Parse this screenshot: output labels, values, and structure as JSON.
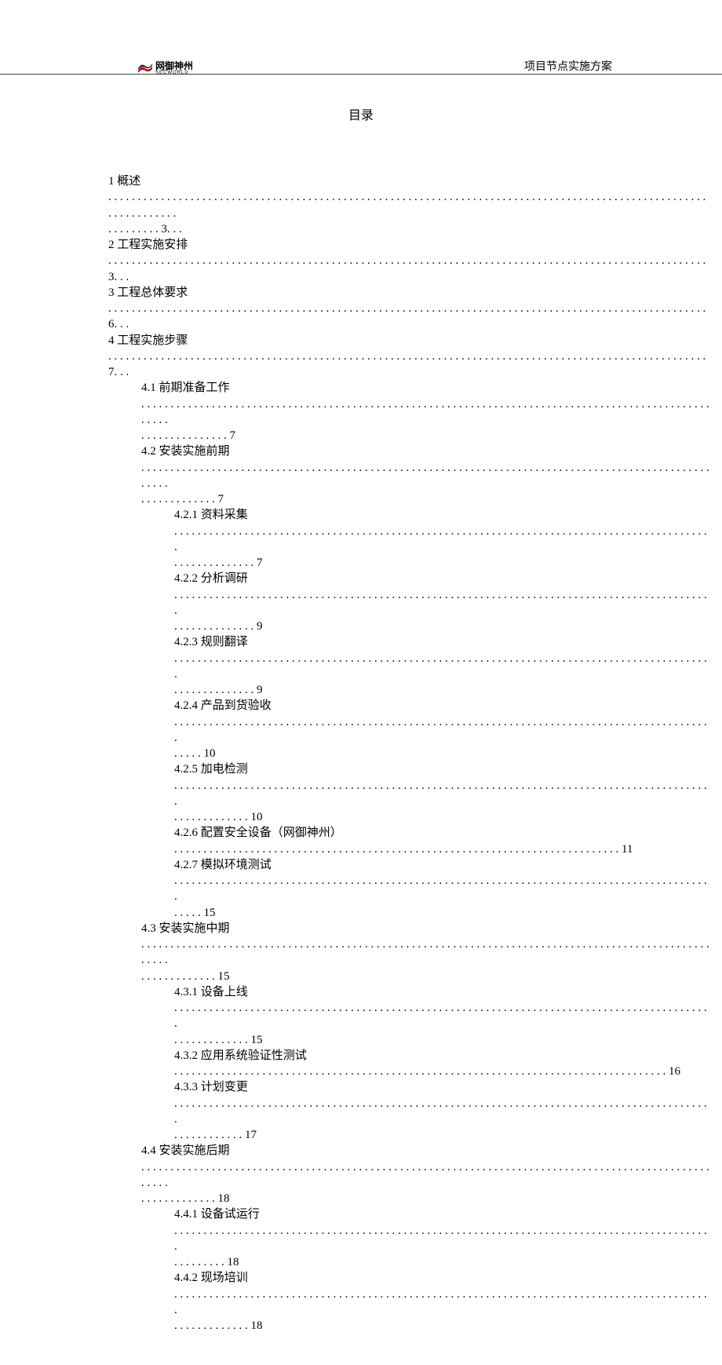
{
  "header": {
    "logo_cn": "网御神州",
    "logo_en": "SECWORLD",
    "doc_title": "项目节点实施方案"
  },
  "toc_heading": "目录",
  "entries": [
    {
      "lvl": 0,
      "lines": [
        "1 概述",
        ". . . . . . . . . . . . . . . . . . . . . . . . . . . . . . . . . . . . . . . . . . . . . . . . . . . . . . . . . . . . . . . . . . . . . . . . . . . . . . . . . . . . . . . . . . . . . . . . . . . . . . . . . . . . . . . . . .",
        ". . . . . . . . . 3. . ."
      ]
    },
    {
      "lvl": 0,
      "lines": [
        "2 工程实施安排",
        ". . . . . . . . . . . . . . . . . . . . . . . . . . . . . . . . . . . . . . . . . . . . . . . . . . . . . . . . . . . . . . . . . . . . . . . . . . . . . . . . . . . . . . . . . . . . . . . . . . . . . . 3. . ."
      ]
    },
    {
      "lvl": 0,
      "lines": [
        "3 工程总体要求",
        ". . . . . . . . . . . . . . . . . . . . . . . . . . . . . . . . . . . . . . . . . . . . . . . . . . . . . . . . . . . . . . . . . . . . . . . . . . . . . . . . . . . . . . . . . . . . . . . . . . . . . . 6. . ."
      ]
    },
    {
      "lvl": 0,
      "lines": [
        "4 工程实施步骤",
        ". . . . . . . . . . . . . . . . . . . . . . . . . . . . . . . . . . . . . . . . . . . . . . . . . . . . . . . . . . . . . . . . . . . . . . . . . . . . . . . . . . . . . . . . . . . . . . . . . . . . . . 7. . ."
      ]
    },
    {
      "lvl": 1,
      "lines": [
        "4.1 前期准备工作",
        ". . . . . . . . . . . . . . . . . . . . . . . . . . . . . . . . . . . . . . . . . . . . . . . . . . . . . . . . . . . . . . . . . . . . . . . . . . . . . . . . . . . . . . . . . . . . . . . . . . . . . .",
        ". . . . . . . . . . . . . . . 7"
      ]
    },
    {
      "lvl": 1,
      "lines": [
        "4.2 安装实施前期",
        ". . . . . . . . . . . . . . . . . . . . . . . . . . . . . . . . . . . . . . . . . . . . . . . . . . . . . . . . . . . . . . . . . . . . . . . . . . . . . . . . . . . . . . . . . . . . . . . . . . . . . .",
        ". . . . . . . . . . . . . 7"
      ]
    },
    {
      "lvl": 2,
      "lines": [
        "4.2.1 资料采集",
        ". . . . . . . . . . . . . . . . . . . . . . . . . . . . . . . . . . . . . . . . . . . . . . . . . . . . . . . . . . . . . . . . . . . . . . . . . . . . . . . . . . . . . . . . . . . .",
        ". . . . . . . . . . . . . . 7"
      ]
    },
    {
      "lvl": 2,
      "lines": [
        "4.2.2 分析调研",
        ". . . . . . . . . . . . . . . . . . . . . . . . . . . . . . . . . . . . . . . . . . . . . . . . . . . . . . . . . . . . . . . . . . . . . . . . . . . . . . . . . . . . . . . . . . . .",
        ". . . . . . . . . . . . . . 9"
      ]
    },
    {
      "lvl": 2,
      "lines": [
        "4.2.3 规则翻译",
        ". . . . . . . . . . . . . . . . . . . . . . . . . . . . . . . . . . . . . . . . . . . . . . . . . . . . . . . . . . . . . . . . . . . . . . . . . . . . . . . . . . . . . . . . . . . .",
        ". . . . . . . . . . . . . . 9"
      ]
    },
    {
      "lvl": 2,
      "lines": [
        "4.2.4 产品到货验收",
        ". . . . . . . . . . . . . . . . . . . . . . . . . . . . . . . . . . . . . . . . . . . . . . . . . . . . . . . . . . . . . . . . . . . . . . . . . . . . . . . . . . . . . . . . . . . .",
        ". . . . . 10"
      ]
    },
    {
      "lvl": 2,
      "lines": [
        "4.2.5 加电检测",
        ". . . . . . . . . . . . . . . . . . . . . . . . . . . . . . . . . . . . . . . . . . . . . . . . . . . . . . . . . . . . . . . . . . . . . . . . . . . . . . . . . . . . . . . . . . . .",
        ". . . . . . . . . . . . . 10"
      ]
    },
    {
      "lvl": 2,
      "lines": [
        "4.2.6 配置安全设备（网御神州）",
        ". . . . . . . . . . . . . . . . . . . . . . . . . . . . . . . . . . . . . . . . . . . . . . . . . . . . . . . . . . . . . . . . . . . . . . . . . . . . 11"
      ]
    },
    {
      "lvl": 2,
      "lines": [
        "4.2.7 模拟环境测试",
        ". . . . . . . . . . . . . . . . . . . . . . . . . . . . . . . . . . . . . . . . . . . . . . . . . . . . . . . . . . . . . . . . . . . . . . . . . . . . . . . . . . . . . . . . . . . .",
        ". . . . . 15"
      ]
    },
    {
      "lvl": 1,
      "lines": [
        "4.3 安装实施中期",
        ". . . . . . . . . . . . . . . . . . . . . . . . . . . . . . . . . . . . . . . . . . . . . . . . . . . . . . . . . . . . . . . . . . . . . . . . . . . . . . . . . . . . . . . . . . . . . . . . . . . . . .",
        ". . . . . . . . . . . . . 15"
      ]
    },
    {
      "lvl": 2,
      "lines": [
        "4.3.1 设备上线",
        ". . . . . . . . . . . . . . . . . . . . . . . . . . . . . . . . . . . . . . . . . . . . . . . . . . . . . . . . . . . . . . . . . . . . . . . . . . . . . . . . . . . . . . . . . . . .",
        ". . . . . . . . . . . . . 15"
      ]
    },
    {
      "lvl": 2,
      "lines": [
        "4.3.2 应用系统验证性测试",
        ". . . . . . . . . . . . . . . . . . . . . . . . . . . . . . . . . . . . . . . . . . . . . . . . . . . . . . . . . . . . . . . . . . . . . . . . . . . . . . . . . . . . 16"
      ]
    },
    {
      "lvl": 2,
      "lines": [
        "4.3.3 计划变更",
        ". . . . . . . . . . . . . . . . . . . . . . . . . . . . . . . . . . . . . . . . . . . . . . . . . . . . . . . . . . . . . . . . . . . . . . . . . . . . . . . . . . . . . . . . . . . .",
        ". . . . . . . . . . . . 17"
      ]
    },
    {
      "lvl": 1,
      "lines": [
        "4.4 安装实施后期",
        ". . . . . . . . . . . . . . . . . . . . . . . . . . . . . . . . . . . . . . . . . . . . . . . . . . . . . . . . . . . . . . . . . . . . . . . . . . . . . . . . . . . . . . . . . . . . . . . . . . . . . .",
        ". . . . . . . . . . . . . 18"
      ]
    },
    {
      "lvl": 2,
      "lines": [
        "4.4.1 设备试运行",
        ". . . . . . . . . . . . . . . . . . . . . . . . . . . . . . . . . . . . . . . . . . . . . . . . . . . . . . . . . . . . . . . . . . . . . . . . . . . . . . . . . . . . . . . . . . . .",
        ". . . . . . . . . 18"
      ]
    },
    {
      "lvl": 2,
      "lines": [
        "4.4.2 现场培训",
        ". . . . . . . . . . . . . . . . . . . . . . . . . . . . . . . . . . . . . . . . . . . . . . . . . . . . . . . . . . . . . . . . . . . . . . . . . . . . . . . . . . . . . . . . . . . .",
        ". . . . . . . . . . . . . 18"
      ]
    }
  ]
}
